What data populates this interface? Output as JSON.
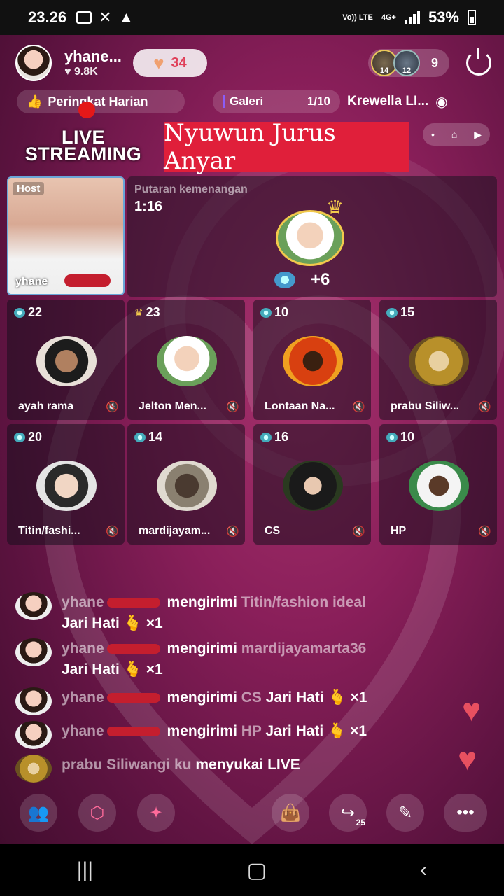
{
  "status": {
    "time": "23.26",
    "signal_top": "Vo)) LTE",
    "signal_bottom": "4G+",
    "battery": "53%"
  },
  "host": {
    "name": "yhane...",
    "likes": "9.8K",
    "hearts": "34"
  },
  "viewers": {
    "badge1": "14",
    "badge2": "12",
    "count": "9"
  },
  "ribbon": {
    "ranking": "Peringkat Harian",
    "gallery": "Galeri",
    "gallery_page": "1/10",
    "song": "Krewella LI..."
  },
  "live": {
    "line1": "LIVE",
    "line2": "STREAMING",
    "banner": "Nyuwun Jurus Anyar"
  },
  "host_tile": {
    "tag": "Host",
    "name": "yhane"
  },
  "win": {
    "label": "Putaran kemenangan",
    "timer": "1:16",
    "bonus": "+6"
  },
  "seats": [
    {
      "level": "22",
      "name": "ayah rama"
    },
    {
      "level": "23",
      "name": "Jelton Men..."
    },
    {
      "level": "10",
      "name": "Lontaan Na..."
    },
    {
      "level": "15",
      "name": "prabu Siliw..."
    },
    {
      "level": "20",
      "name": "Titin/fashi..."
    },
    {
      "level": "14",
      "name": "mardijayam..."
    },
    {
      "level": "16",
      "name": "CS"
    },
    {
      "level": "10",
      "name": "HP"
    }
  ],
  "chat": [
    {
      "user": "yhane",
      "verb": "mengirimi",
      "target": "Titin/fashion ideal",
      "gift": "Jari Hati",
      "qty": "×1"
    },
    {
      "user": "yhane",
      "verb": "mengirimi",
      "target": "mardijayamarta36",
      "gift": "Jari Hati",
      "qty": "×1"
    },
    {
      "user": "yhane",
      "verb": "mengirimi",
      "target": "CS",
      "gift": "Jari Hati",
      "qty": "×1"
    },
    {
      "user": "yhane",
      "verb": "mengirimi",
      "target": "HP",
      "gift": "Jari Hati",
      "qty": "×1"
    },
    {
      "user": "prabu Siliwangi ku",
      "verb": "menyukai LIVE"
    }
  ],
  "toolbar": {
    "share_count": "25"
  },
  "icons": {
    "people": "people-icon",
    "box": "cube-icon",
    "book": "book-icon",
    "bag": "shopping-bag-icon",
    "share": "share-icon",
    "edit": "pen-icon",
    "more": "more-icon",
    "power": "power-icon"
  },
  "colors": {
    "banner": "#e01f3a",
    "accent_heart": "#e0405a",
    "host_border": "#6aa6d8",
    "crown": "#f2c94c"
  }
}
